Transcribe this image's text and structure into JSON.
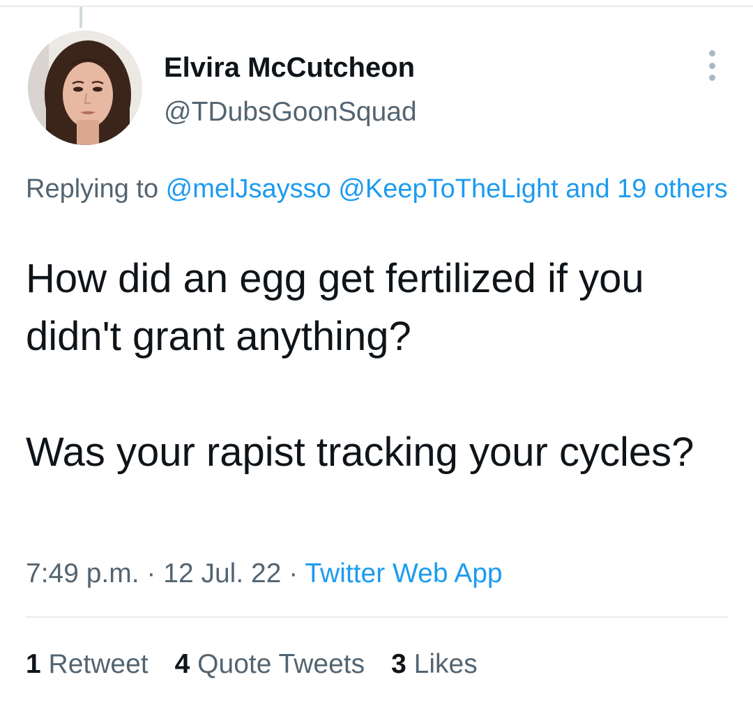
{
  "tweet": {
    "author": {
      "display_name": "Elvira McCutcheon",
      "handle": "@TDubsGoonSquad"
    },
    "reply_context": {
      "prefix": "Replying to ",
      "mentions": [
        "@melJsaysso",
        "@KeepToTheLight"
      ],
      "others": "and 19 others"
    },
    "text": {
      "paragraph1": "How did an egg get fertilized if you didn't grant anything?",
      "paragraph2": "Was your rapist tracking your cycles?"
    },
    "meta": {
      "time": "7:49 p.m.",
      "separator": " · ",
      "date": "12 Jul. 22",
      "source": "Twitter Web App"
    },
    "stats": {
      "retweets": {
        "count": "1",
        "label": "Retweet"
      },
      "quote_tweets": {
        "count": "4",
        "label": "Quote Tweets"
      },
      "likes": {
        "count": "3",
        "label": "Likes"
      }
    }
  },
  "icons": {
    "more": "more-vertical-icon"
  },
  "colors": {
    "link": "#1d9bf0",
    "secondary_text": "#536471",
    "primary_text": "#0f1419"
  }
}
